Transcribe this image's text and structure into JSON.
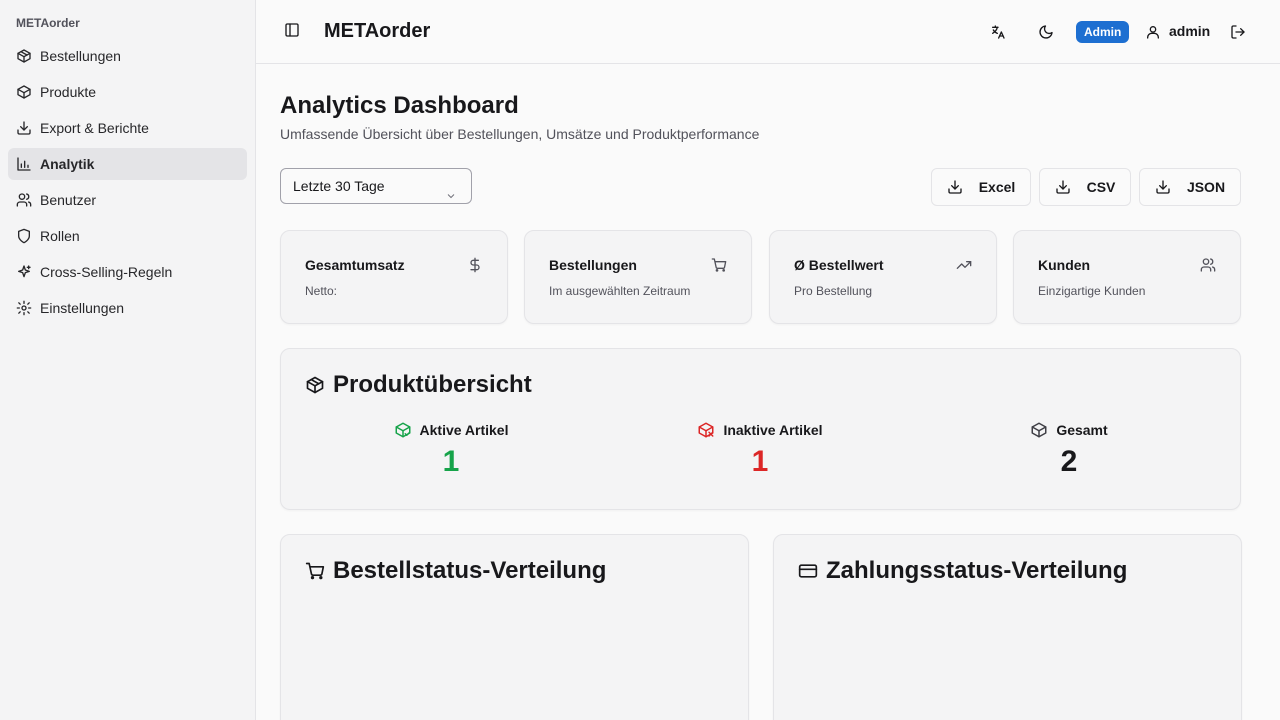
{
  "sidebar": {
    "brand": "METAorder",
    "items": [
      {
        "label": "Bestellungen",
        "icon": "package-icon"
      },
      {
        "label": "Produkte",
        "icon": "box-icon"
      },
      {
        "label": "Export & Berichte",
        "icon": "download-icon"
      },
      {
        "label": "Analytik",
        "icon": "bar-chart-icon",
        "active": true
      },
      {
        "label": "Benutzer",
        "icon": "users-icon"
      },
      {
        "label": "Rollen",
        "icon": "shield-icon"
      },
      {
        "label": "Cross-Selling-Regeln",
        "icon": "sparkles-icon"
      },
      {
        "label": "Einstellungen",
        "icon": "gear-icon"
      }
    ]
  },
  "header": {
    "title": "METAorder",
    "role_badge": "Admin",
    "username": "admin"
  },
  "main": {
    "title": "Analytics Dashboard",
    "subtitle": "Umfassende Übersicht über Bestellungen, Umsätze und Produktperformance",
    "range_select": "Letzte 30 Tage",
    "export_buttons": [
      "Excel",
      "CSV",
      "JSON"
    ],
    "stat_cards": [
      {
        "title": "Gesamtumsatz",
        "subtitle": "Netto:",
        "icon": "dollar-icon"
      },
      {
        "title": "Bestellungen",
        "subtitle": "Im ausgewählten Zeitraum",
        "icon": "cart-icon"
      },
      {
        "title": "Ø Bestellwert",
        "subtitle": "Pro Bestellung",
        "icon": "trending-up-icon"
      },
      {
        "title": "Kunden",
        "subtitle": "Einzigartige Kunden",
        "icon": "users-icon"
      }
    ],
    "product_overview": {
      "title": "Produktübersicht",
      "metrics": [
        {
          "label": "Aktive Artikel",
          "value": "1",
          "color": "#16a34a"
        },
        {
          "label": "Inaktive Artikel",
          "value": "1",
          "color": "#dc2626"
        },
        {
          "label": "Gesamt",
          "value": "2",
          "color": "#18181b"
        }
      ]
    },
    "order_status_title": "Bestellstatus-Verteilung",
    "payment_status_title": "Zahlungsstatus-Verteilung"
  }
}
